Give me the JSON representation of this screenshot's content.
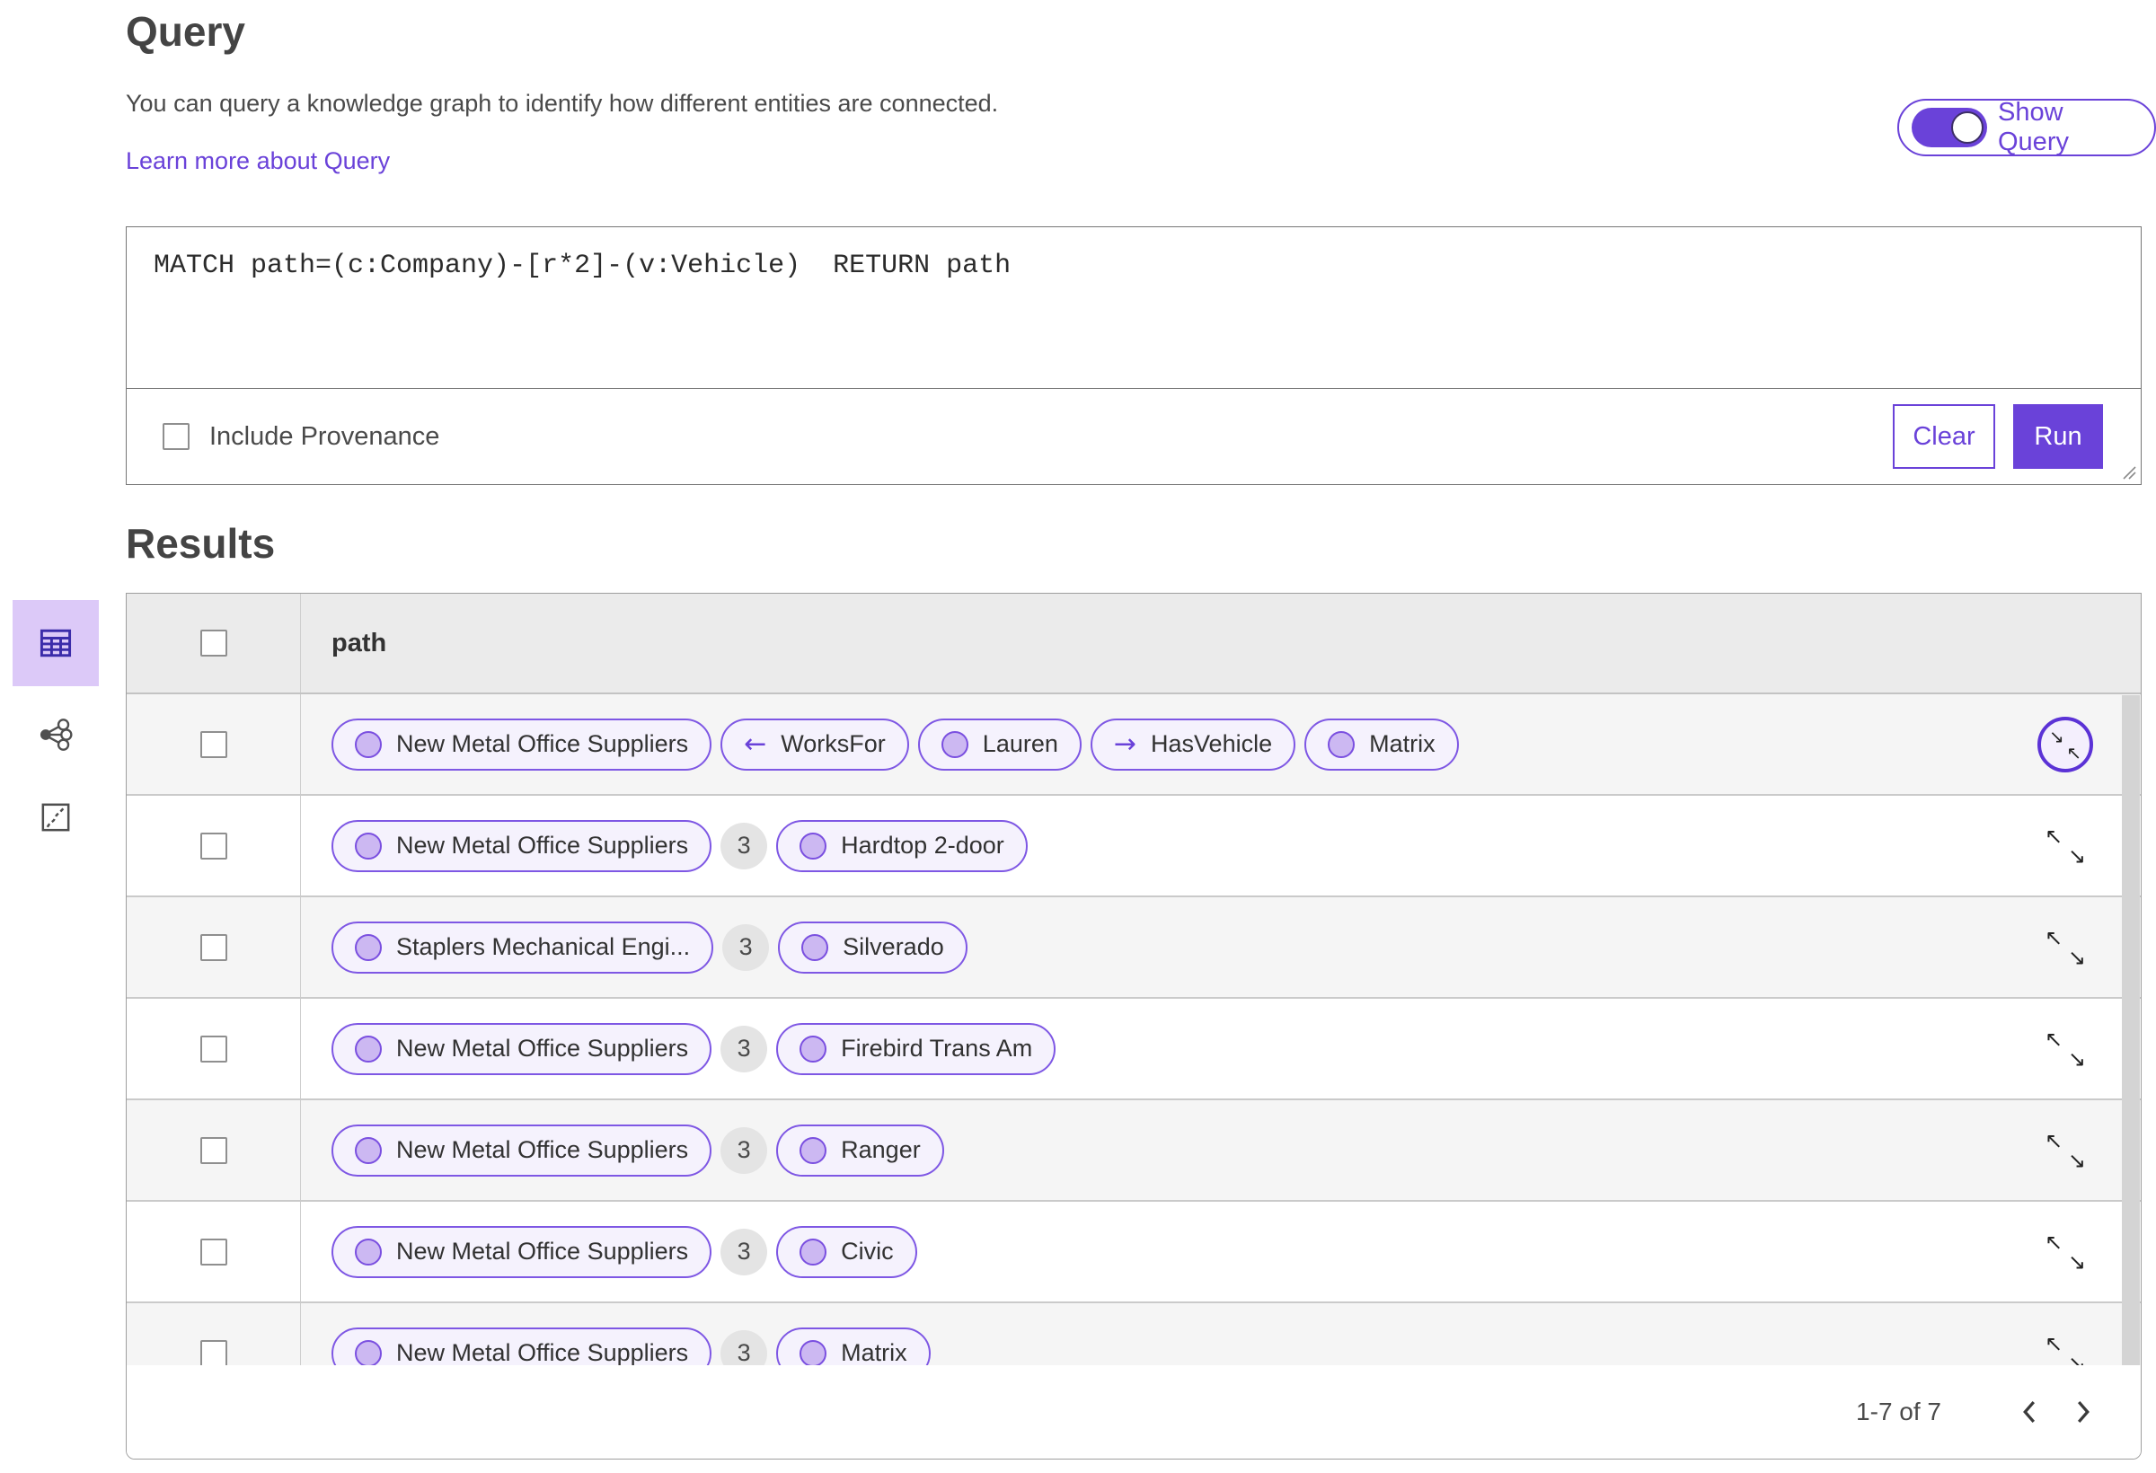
{
  "colors": {
    "accent_purple": "#6a42d9",
    "pill_border_purple": "#7e57e4",
    "pill_background": "#f5f2fd",
    "pill_circle_fill": "#ccb8f2",
    "selected_tab_background": "#dcc9f8",
    "selected_tab_icon": "#3b2caa",
    "table_header_background": "#ebebeb",
    "alt_row_background": "#f5f5f5",
    "count_badge_background": "#e4e4e4",
    "text_dark": "#4a4a4a"
  },
  "query_panel": {
    "title": "Query",
    "description": "You can query a knowledge graph to identify how different entities are connected.",
    "learn_more_link": "Learn more about Query",
    "show_query_toggle": {
      "label": "Show Query",
      "state": "on"
    },
    "query_text": "MATCH path=(c:Company)-[r*2]-(v:Vehicle)  RETURN path",
    "include_provenance_label": "Include Provenance",
    "include_provenance_checked": false,
    "clear_button": "Clear",
    "run_button": "Run"
  },
  "results_panel": {
    "title": "Results",
    "view_tabs": [
      {
        "name": "table-view",
        "icon": "table-icon",
        "selected": true
      },
      {
        "name": "graph-view",
        "icon": "graph-icon",
        "selected": false
      },
      {
        "name": "map-view",
        "icon": "map-icon",
        "selected": false
      }
    ],
    "table": {
      "column_header": "path",
      "rows": [
        {
          "e1": "New Metal Office Suppliers",
          "r1": "WorksFor",
          "e2": "Lauren",
          "r2": "HasVehicle",
          "e3": "Matrix"
        },
        {
          "e1": "New Metal Office Suppliers",
          "count": "3",
          "e2": "Hardtop 2-door"
        },
        {
          "e1": "Staplers Mechanical Engi...",
          "count": "3",
          "e2": "Silverado"
        },
        {
          "e1": "New Metal Office Suppliers",
          "count": "3",
          "e2": "Firebird Trans Am"
        },
        {
          "e1": "New Metal Office Suppliers",
          "count": "3",
          "e2": "Ranger"
        },
        {
          "e1": "New Metal Office Suppliers",
          "count": "3",
          "e2": "Civic"
        },
        {
          "e1": "New Metal Office Suppliers",
          "count": "3",
          "e2": "Matrix"
        }
      ],
      "pagination": {
        "range_label": "1-7 of 7"
      }
    }
  },
  "icons": {
    "arrow_left": "←",
    "arrow_right": "→",
    "arrow_nw": "↖",
    "arrow_se": "↘"
  }
}
